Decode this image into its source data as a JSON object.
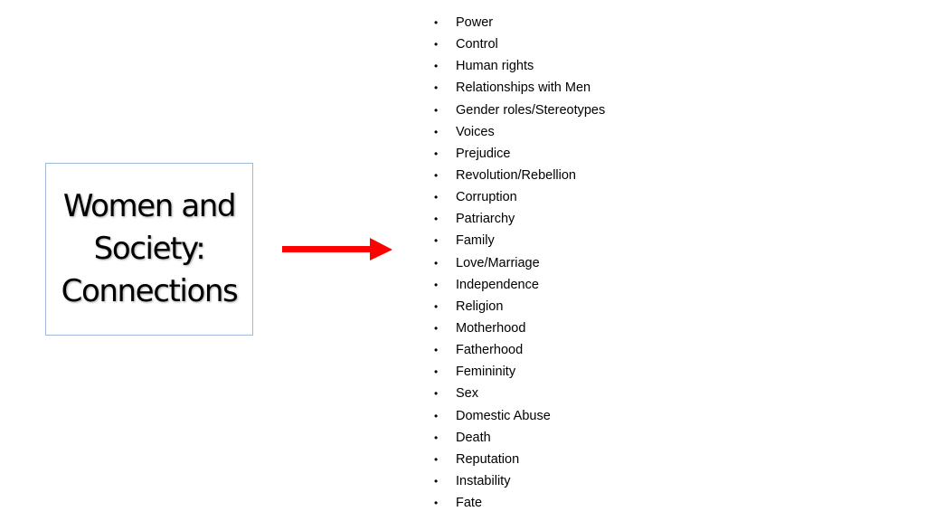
{
  "slide": {
    "title_lines": [
      "Women and",
      "Society:",
      "Connections"
    ],
    "accent_color": "#ff0000",
    "box_border_color": "#9dbbd9",
    "arrow_icon": "right-arrow",
    "bullet_glyph": "•",
    "topics": [
      "Power",
      "Control",
      "Human rights",
      "Relationships with Men",
      "Gender roles/Stereotypes",
      "Voices",
      "Prejudice",
      "Revolution/Rebellion",
      "Corruption",
      "Patriarchy",
      "Family",
      "Love/Marriage",
      "Independence",
      "Religion",
      "Motherhood",
      "Fatherhood",
      "Femininity",
      "Sex",
      "Domestic Abuse",
      "Death",
      "Reputation",
      "Instability",
      "Fate"
    ]
  }
}
